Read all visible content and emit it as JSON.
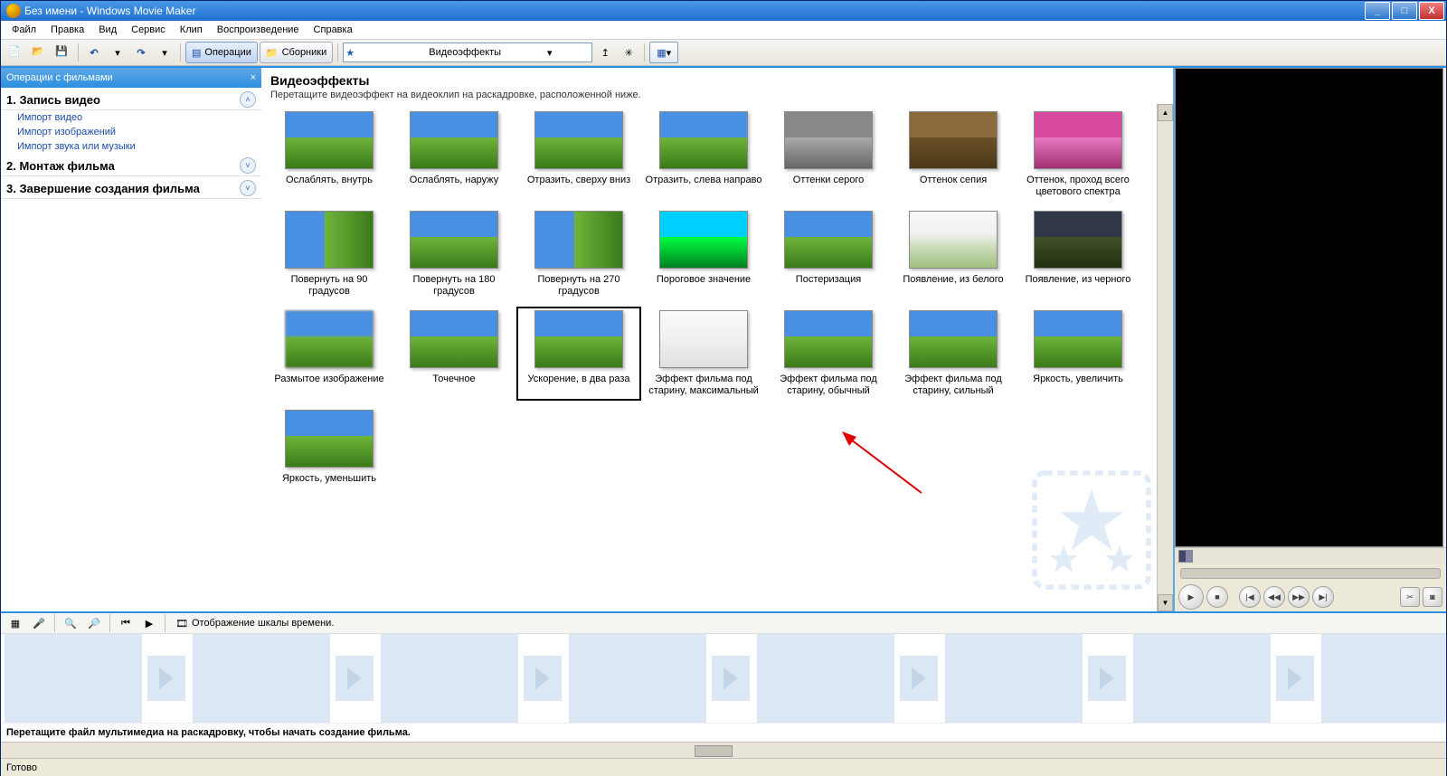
{
  "title": "Без имени - Windows Movie Maker",
  "menu": [
    "Файл",
    "Правка",
    "Вид",
    "Сервис",
    "Клип",
    "Воспроизведение",
    "Справка"
  ],
  "toolbar": {
    "ops": "Операции",
    "coll": "Сборники",
    "combo": "Видеоэффекты"
  },
  "tasks": {
    "header": "Операции с фильмами",
    "sec1": {
      "title": "1. Запись видео",
      "links": [
        "Импорт видео",
        "Импорт изображений",
        "Импорт звука или музыки"
      ]
    },
    "sec2": {
      "title": "2. Монтаж фильма"
    },
    "sec3": {
      "title": "3. Завершение создания фильма"
    }
  },
  "content": {
    "title": "Видеоэффекты",
    "sub": "Перетащите видеоэффект на видеоклип на раскадровке, расположенной ниже.",
    "effects": [
      {
        "l": "Ослаблять, внутрь"
      },
      {
        "l": "Ослаблять, наружу"
      },
      {
        "l": "Отразить, сверху вниз"
      },
      {
        "l": "Отразить, слева направо"
      },
      {
        "l": "Оттенки серого",
        "t": "t-gray"
      },
      {
        "l": "Оттенок сепия",
        "t": "t-sepia"
      },
      {
        "l": "Оттенок, проход всего цветового спектра",
        "t": "t-pink"
      },
      {
        "l": "Повернуть на 90 градусов",
        "t": "t-rot"
      },
      {
        "l": "Повернуть на 180 градусов"
      },
      {
        "l": "Повернуть на 270 градусов",
        "t": "t-rot"
      },
      {
        "l": "Пороговое значение",
        "t": "t-post"
      },
      {
        "l": "Постеризация"
      },
      {
        "l": "Появление, из белого",
        "t": "t-white"
      },
      {
        "l": "Появление, из черного",
        "t": "t-blk"
      },
      {
        "l": "Размытое изображение",
        "t": "t-blur"
      },
      {
        "l": "Точечное"
      },
      {
        "l": "Ускорение, в два раза",
        "sel": true
      },
      {
        "l": "Эффект фильма под старину, максимальный",
        "t": "t-old"
      },
      {
        "l": "Эффект фильма под старину, обычный"
      },
      {
        "l": "Эффект фильма под старину, сильный"
      },
      {
        "l": "Яркость, увеличить"
      },
      {
        "l": "Яркость, уменьшить"
      }
    ]
  },
  "timeline": {
    "toggle": "Отображение шкалы времени.",
    "hint": "Перетащите файл мультимедиа на раскадровку, чтобы начать создание фильма."
  },
  "status": "Готово"
}
